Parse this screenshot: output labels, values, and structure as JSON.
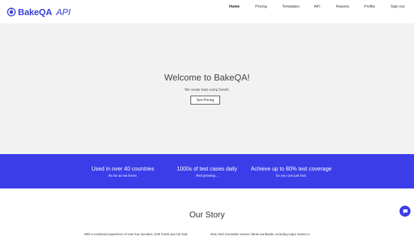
{
  "brand": {
    "name": "BakeQA",
    "suffix": "API",
    "color": "#3a3fd8"
  },
  "nav": {
    "items": [
      {
        "label": "Home",
        "active": true
      },
      {
        "label": "Pricing",
        "active": false
      },
      {
        "label": "Templates",
        "active": false
      },
      {
        "label": "API",
        "active": false
      },
      {
        "label": "Reports",
        "active": false
      },
      {
        "label": "Profile",
        "active": false
      },
      {
        "label": "Sign out",
        "active": false
      }
    ]
  },
  "hero": {
    "title": "Welcome to BakeQA!",
    "subtitle": "We create tests using GenAI.",
    "button_label": "See Pricing"
  },
  "stats": {
    "background": "#3b3de9",
    "items": [
      {
        "title": "Used in over 40 countries",
        "subtitle": "As far as we know."
      },
      {
        "title": "1000s of test cases daily",
        "subtitle": "And growing..."
      },
      {
        "title": "Achieve up to 80% test coverage",
        "subtitle": "So you can just test."
      }
    ]
  },
  "story": {
    "title": "Our Story",
    "col_left": "With a combined experience of over four decades, both Frank and Ash had",
    "col_right": "Now, their innovation serves clients worldwide, including major names in"
  },
  "chat": {
    "icon": "chat-bubble-icon"
  }
}
